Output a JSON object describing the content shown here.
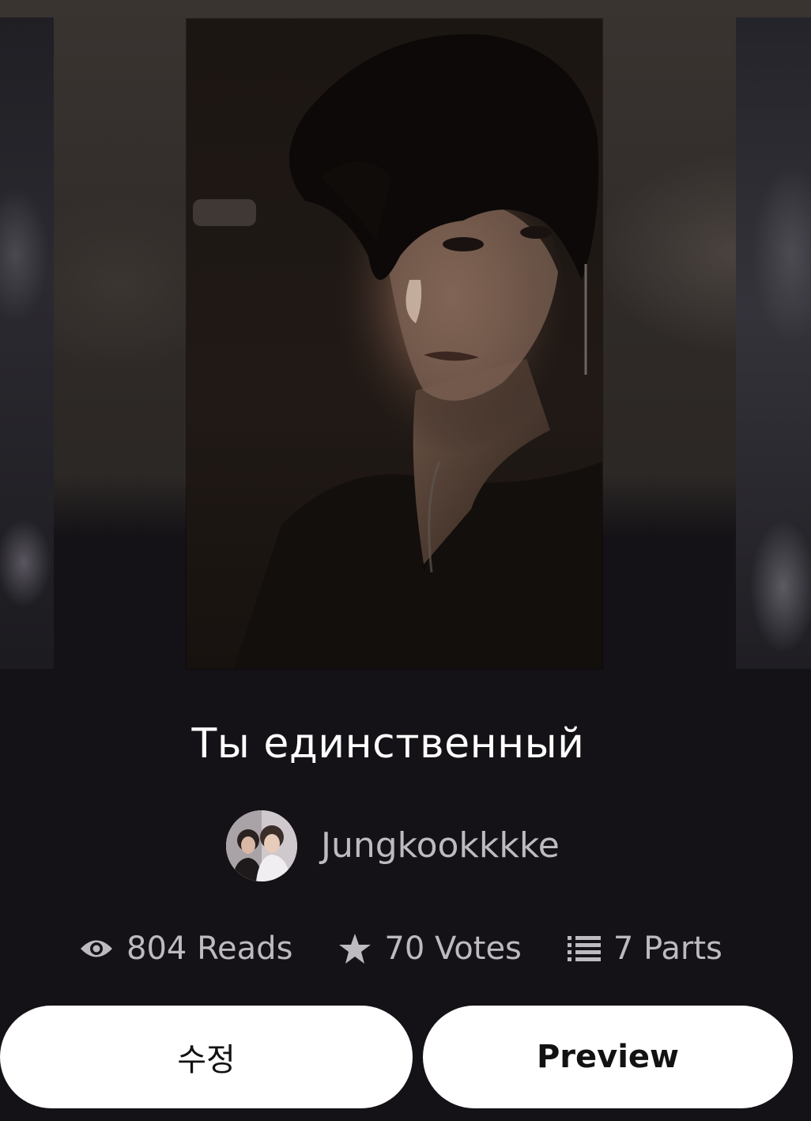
{
  "story": {
    "title": "Ты единственный",
    "author": "Jungkookkkke"
  },
  "stats": {
    "reads": "804 Reads",
    "votes": "70 Votes",
    "parts": "7 Parts"
  },
  "icons": {
    "reads": "eye-icon",
    "votes": "star-icon",
    "parts": "list-icon"
  },
  "buttons": {
    "edit": "수정",
    "preview": "Preview"
  },
  "colors": {
    "background": "#141216",
    "title": "#ffffff",
    "muted_text": "#bdbbc0",
    "button_bg": "#ffffff",
    "button_text": "#121212"
  }
}
